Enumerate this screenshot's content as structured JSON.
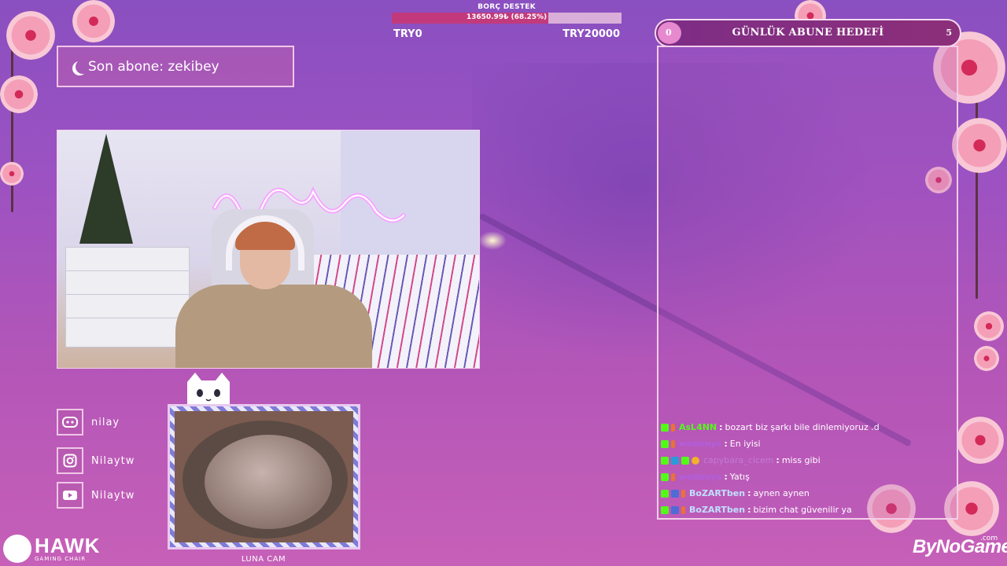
{
  "donation": {
    "title": "BORÇ DESTEK",
    "progress_text": "13650.99₺ (68.25%)",
    "progress_fraction": 0.6825,
    "min_label": "TRY0",
    "max_label": "TRY20000"
  },
  "last_sub": {
    "text": "Son abone: zekibey"
  },
  "socials": [
    {
      "icon": "discord-icon",
      "label": "nilay"
    },
    {
      "icon": "instagram-icon",
      "label": "Nilaytw"
    },
    {
      "icon": "youtube-icon",
      "label": "Nilaytw"
    }
  ],
  "catcam": {
    "label": "LUNA CAM"
  },
  "subgoal": {
    "current": "0",
    "title": "GÜNLÜK ABUNE HEDEFİ",
    "target": "5"
  },
  "chat": {
    "messages": [
      {
        "user": "AsL4NN",
        "user_color": "#53fc18",
        "text": "bozart biz şarkı bile dinlemiyoruz .d"
      },
      {
        "user": "wommys",
        "user_color": "#b15fe0",
        "text": "En iyisi"
      },
      {
        "user": "capybara_cicem",
        "user_color": "#c27ad8",
        "text": "miss gibi"
      },
      {
        "user": "wommys",
        "user_color": "#b15fe0",
        "text": "Yatış"
      },
      {
        "user": "BoZARTben",
        "user_color": "#c0e0ff",
        "text": "aynen aynen"
      },
      {
        "user": "BoZARTben",
        "user_color": "#c0e0ff",
        "text": "bizim chat güvenilir ya"
      }
    ]
  },
  "branding": {
    "hawk": "HAWK",
    "hawk_sub": "GAMING CHAIR",
    "bynogame": "ByNoGame",
    "bynogame_suffix": ".com"
  },
  "colors": {
    "background_top": "#8a4fc0",
    "background_bottom": "#c660b8",
    "accent_pink": "#c23a7c",
    "frame_border": "#f3cdea",
    "kick_green": "#53fc18"
  }
}
